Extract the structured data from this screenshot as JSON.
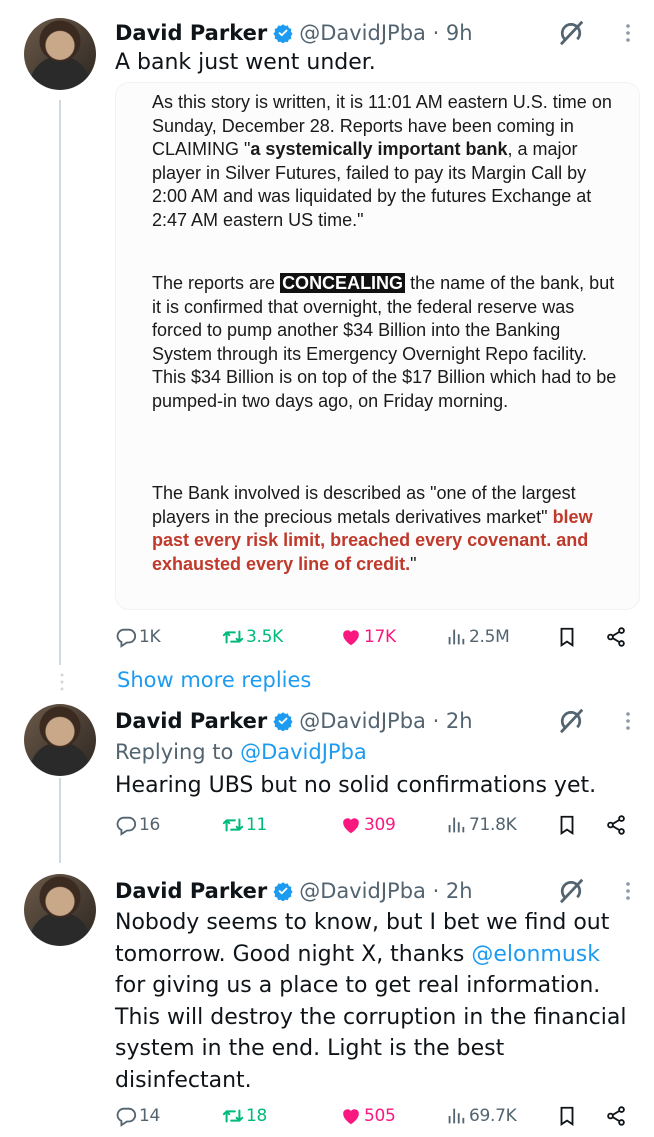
{
  "tweets": [
    {
      "name": "David Parker",
      "handle": "@DavidJPba · 9h",
      "text": "A bank just went under.",
      "quote": {
        "p1": "As this story is written, it is 11:01 AM eastern U.S. time on Sunday, December 28.  Reports have been coming in CLAIMING \"",
        "p1_bold": "a systemically important bank",
        "p1_rest": ", a major player in Silver Futures, failed to pay its Margin Call by 2:00 AM and was liquidated by the futures Exchange at 2:47 AM eastern US time.\"",
        "p2_pre": "The reports are ",
        "p2_hl": "CONCEALING",
        "p2_rest": " the name of the bank, but it is confirmed that overnight, the federal reserve was forced to pump another $34 Billion into the Banking System through its Emergency Overnight Repo facility.   This $34 Billion is on top of the $17 Billion which had to be pumped-in two days ago, on Friday morning.",
        "p3_pre": "The Bank involved is described as \"one of the largest players in the precious metals derivatives market\" ",
        "p3_red": "blew past every risk limit, breached every covenant. and exhausted every line of credit.",
        "p3_end": "\""
      },
      "replies": "1K",
      "reposts": "3.5K",
      "likes": "17K",
      "views": "2.5M"
    },
    {
      "name": "David Parker",
      "handle": "@DavidJPba · 2h",
      "replying_prefix": "Replying to ",
      "replying_to": "@DavidJPba",
      "text": "Hearing UBS but no solid confirmations yet.",
      "replies": "16",
      "reposts": "11",
      "likes": "309",
      "views": "71.8K"
    },
    {
      "name": "David Parker",
      "handle": "@DavidJPba · 2h",
      "text_pre": "Nobody seems to know, but I bet we find out tomorrow. Good night X, thanks ",
      "mention": "@elonmusk",
      "text_post": " for giving us a place to get real information. This will destroy the corruption in the financial system in the end. Light is the best disinfectant.",
      "replies": "14",
      "reposts": "18",
      "likes": "505",
      "views": "69.7K"
    }
  ],
  "show_more_replies": "Show more replies",
  "colors": {
    "accent": "#1d9bf0",
    "like": "#f91880",
    "repost": "#00ba7c",
    "muted": "#536471"
  }
}
